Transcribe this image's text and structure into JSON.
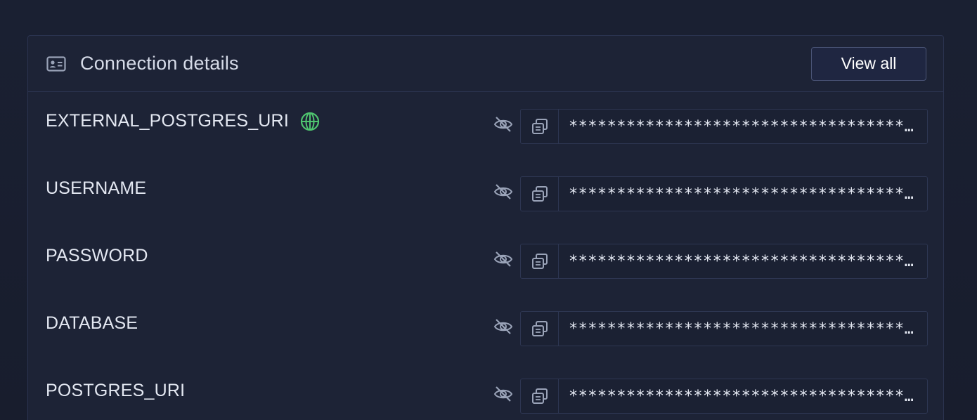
{
  "card": {
    "title": "Connection details",
    "title_icon": "id-card-icon",
    "view_all_label": "View all"
  },
  "variables": [
    {
      "name": "EXTERNAL_POSTGRES_URI",
      "public": true,
      "value": "****************************************************"
    },
    {
      "name": "USERNAME",
      "public": false,
      "value": "****************************************************"
    },
    {
      "name": "PASSWORD",
      "public": false,
      "value": "****************************************************"
    },
    {
      "name": "DATABASE",
      "public": false,
      "value": "****************************************************"
    },
    {
      "name": "POSTGRES_URI",
      "public": false,
      "value": "****************************************************"
    }
  ],
  "colors": {
    "background": "#181d2e",
    "card": "#1d2336",
    "border": "#2b3450",
    "globe": "#4fc46f",
    "icon": "#9aa3b8"
  }
}
